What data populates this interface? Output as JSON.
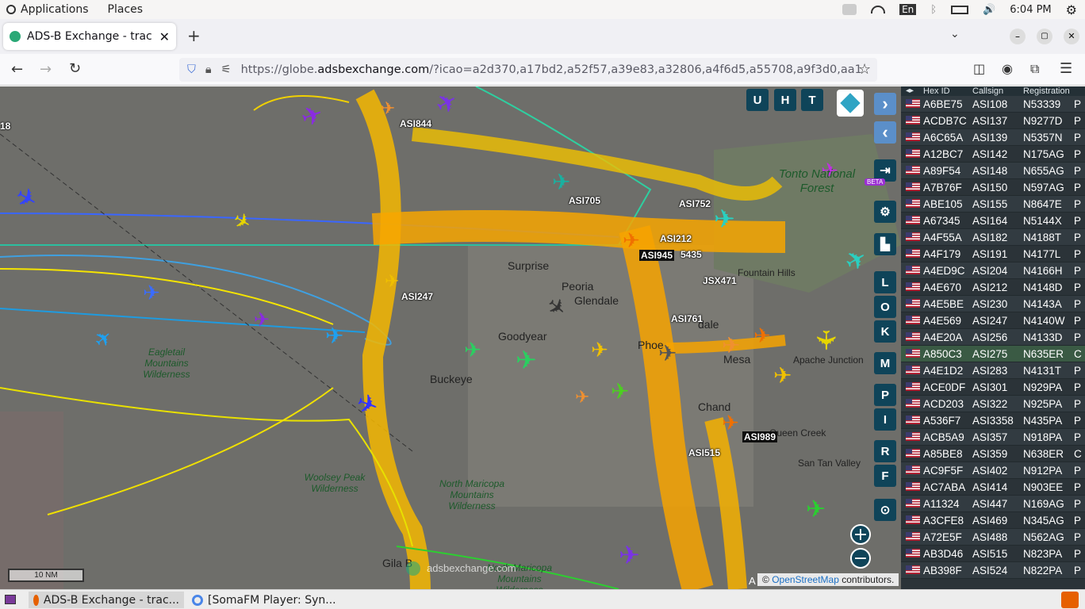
{
  "topbar": {
    "applications": "Applications",
    "places": "Places",
    "keyboard": "En",
    "clock": "6:04 PM"
  },
  "browser": {
    "tab_title": "ADS-B Exchange - track a",
    "url_prefix": "https://globe.",
    "url_domain": "adsbexchange.com",
    "url_rest": "/?icao=a2d370,a17bd2,a52f57,a39e83,a32806,a4f6d5,a55708,a9f3d0,aa1"
  },
  "map": {
    "places": [
      "Surprise",
      "Peoria",
      "Glendale",
      "Goodyear",
      "Buckeye",
      "Apache Junction",
      "San Tan Valley",
      "Queen Creek",
      "Fountain Hills",
      "Phoe",
      "Mesa",
      "dale",
      "Chand",
      "Gila B"
    ],
    "wilderness": [
      "Eagletail Mountains Wilderness",
      "Woolsey Peak Wilderness",
      "North Maricopa Mountains Wilderness",
      "Tonto National Forest",
      "North Maricopa Mountains Wilderness"
    ],
    "labels": [
      "ASI844",
      "ASI705",
      "ASI752",
      "ASI212",
      "ASI945",
      "5435",
      "JSX471",
      "ASI247",
      "ASI761",
      "ASI989",
      "ASI515",
      "18"
    ],
    "scale": "10 NM",
    "attribution_prefix": "©",
    "attribution_link": "OpenStreetMap",
    "attribution_suffix": "contributors.",
    "watermark": "adsbexchange.com",
    "beta": "BETA",
    "view_buttons": [
      "U",
      "H",
      "T"
    ],
    "side_buttons": [
      "L",
      "O",
      "K",
      "M",
      "P",
      "I",
      "R",
      "F"
    ],
    "corner_char": "A"
  },
  "panel": {
    "headers": [
      "Hex ID",
      "Callsign",
      "Registration"
    ],
    "rows": [
      {
        "hex": "A6BE75",
        "cs": "ASI108",
        "reg": "N53339",
        "x": "P"
      },
      {
        "hex": "ACDB7C",
        "cs": "ASI137",
        "reg": "N9277D",
        "x": "P"
      },
      {
        "hex": "A6C65A",
        "cs": "ASI139",
        "reg": "N5357N",
        "x": "P"
      },
      {
        "hex": "A12BC7",
        "cs": "ASI142",
        "reg": "N175AG",
        "x": "P"
      },
      {
        "hex": "A89F54",
        "cs": "ASI148",
        "reg": "N655AG",
        "x": "P"
      },
      {
        "hex": "A7B76F",
        "cs": "ASI150",
        "reg": "N597AG",
        "x": "P"
      },
      {
        "hex": "ABE105",
        "cs": "ASI155",
        "reg": "N8647E",
        "x": "P"
      },
      {
        "hex": "A67345",
        "cs": "ASI164",
        "reg": "N5144X",
        "x": "P"
      },
      {
        "hex": "A4F55A",
        "cs": "ASI182",
        "reg": "N4188T",
        "x": "P"
      },
      {
        "hex": "A4F179",
        "cs": "ASI191",
        "reg": "N4177L",
        "x": "P"
      },
      {
        "hex": "A4ED9C",
        "cs": "ASI204",
        "reg": "N4166H",
        "x": "P"
      },
      {
        "hex": "A4E670",
        "cs": "ASI212",
        "reg": "N4148D",
        "x": "P"
      },
      {
        "hex": "A4E5BE",
        "cs": "ASI230",
        "reg": "N4143A",
        "x": "P"
      },
      {
        "hex": "A4E569",
        "cs": "ASI247",
        "reg": "N4140W",
        "x": "P"
      },
      {
        "hex": "A4E20A",
        "cs": "ASI256",
        "reg": "N4133D",
        "x": "P"
      },
      {
        "hex": "A850C3",
        "cs": "ASI275",
        "reg": "N635ER",
        "x": "C"
      },
      {
        "hex": "A4E1D2",
        "cs": "ASI283",
        "reg": "N4131T",
        "x": "P"
      },
      {
        "hex": "ACE0DF",
        "cs": "ASI301",
        "reg": "N929PA",
        "x": "P"
      },
      {
        "hex": "ACD203",
        "cs": "ASI322",
        "reg": "N925PA",
        "x": "P"
      },
      {
        "hex": "A536F7",
        "cs": "ASI3358",
        "reg": "N435PA",
        "x": "P"
      },
      {
        "hex": "ACB5A9",
        "cs": "ASI357",
        "reg": "N918PA",
        "x": "P"
      },
      {
        "hex": "A85BE8",
        "cs": "ASI359",
        "reg": "N638ER",
        "x": "C"
      },
      {
        "hex": "AC9F5F",
        "cs": "ASI402",
        "reg": "N912PA",
        "x": "P"
      },
      {
        "hex": "AC7ABA",
        "cs": "ASI414",
        "reg": "N903EE",
        "x": "P"
      },
      {
        "hex": "A11324",
        "cs": "ASI447",
        "reg": "N169AG",
        "x": "P"
      },
      {
        "hex": "A3CFE8",
        "cs": "ASI469",
        "reg": "N345AG",
        "x": "P"
      },
      {
        "hex": "A72E5F",
        "cs": "ASI488",
        "reg": "N562AG",
        "x": "P"
      },
      {
        "hex": "AB3D46",
        "cs": "ASI515",
        "reg": "N823PA",
        "x": "P"
      },
      {
        "hex": "AB398F",
        "cs": "ASI524",
        "reg": "N822PA",
        "x": "P"
      }
    ]
  },
  "taskbar": {
    "task1": "ADS-B Exchange - trac...",
    "task2": "[SomaFM Player: Syn..."
  }
}
